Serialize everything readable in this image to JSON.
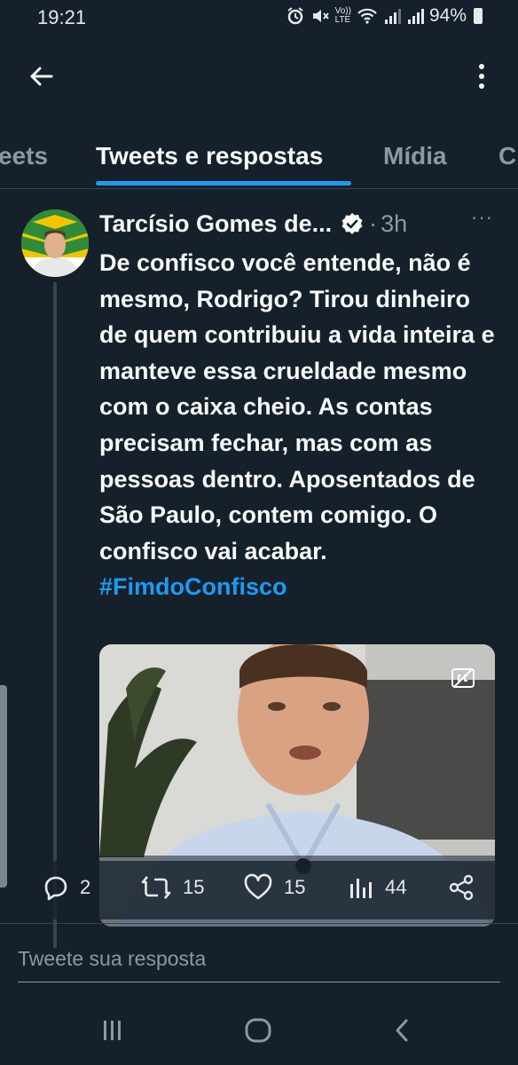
{
  "status_bar": {
    "time": "19:21",
    "lte_label": "LTE",
    "volte_label": "Vo))",
    "battery": "94%"
  },
  "tabs": [
    {
      "label": "eets",
      "active": false
    },
    {
      "label": "Tweets e respostas",
      "active": true
    },
    {
      "label": "Mídia",
      "active": false
    },
    {
      "label": "C",
      "active": false
    }
  ],
  "tweet": {
    "author_name": "Tarcísio Gomes de...",
    "separator": "·",
    "time": "3h",
    "text": "De confisco você entende, não é mesmo, Rodrigo? Tirou dinheiro de quem contribuiu a vida inteira e manteve essa crueldade mesmo com o caixa cheio. As contas precisam fechar, mas com as pessoas dentro. Aposentados de São Paulo, contem comigo. O confisco vai acabar.",
    "hashtag": "#FimdoConfisco",
    "more_label": "···"
  },
  "actions": {
    "replies": "2",
    "retweets": "15",
    "likes": "15",
    "views": "44"
  },
  "reply": {
    "placeholder": "Tweete sua resposta"
  },
  "icons": {
    "back": "back-arrow-icon",
    "more": "more-vertical-icon",
    "verified": "verified-badge-icon",
    "reply": "reply-icon",
    "retweet": "retweet-icon",
    "like": "heart-icon",
    "views": "views-icon",
    "share": "share-icon",
    "captions": "captions-icon"
  },
  "colors": {
    "background": "#15202b",
    "accent": "#1d9bf0",
    "secondary_text": "#8b98a5",
    "border": "#38444d"
  }
}
